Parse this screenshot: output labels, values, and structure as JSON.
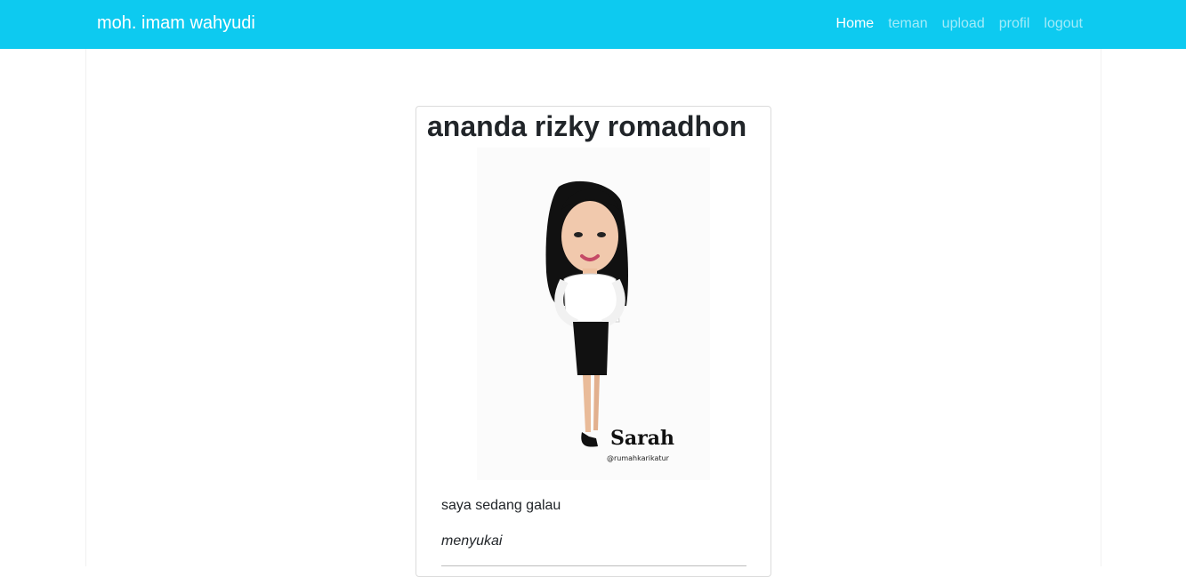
{
  "navbar": {
    "brand": "moh. imam wahyudi",
    "links": [
      {
        "label": "Home",
        "active": true
      },
      {
        "label": "teman",
        "active": false
      },
      {
        "label": "upload",
        "active": false
      },
      {
        "label": "profil",
        "active": false
      },
      {
        "label": "logout",
        "active": false
      }
    ],
    "color": "#0dcaf0"
  },
  "profile_card": {
    "name": "ananda rizky romadhon",
    "photo_caption": "Sarah",
    "photo_handle": "@rumahkarikatur",
    "status": "saya sedang galau",
    "likes_label": "menyukai"
  }
}
